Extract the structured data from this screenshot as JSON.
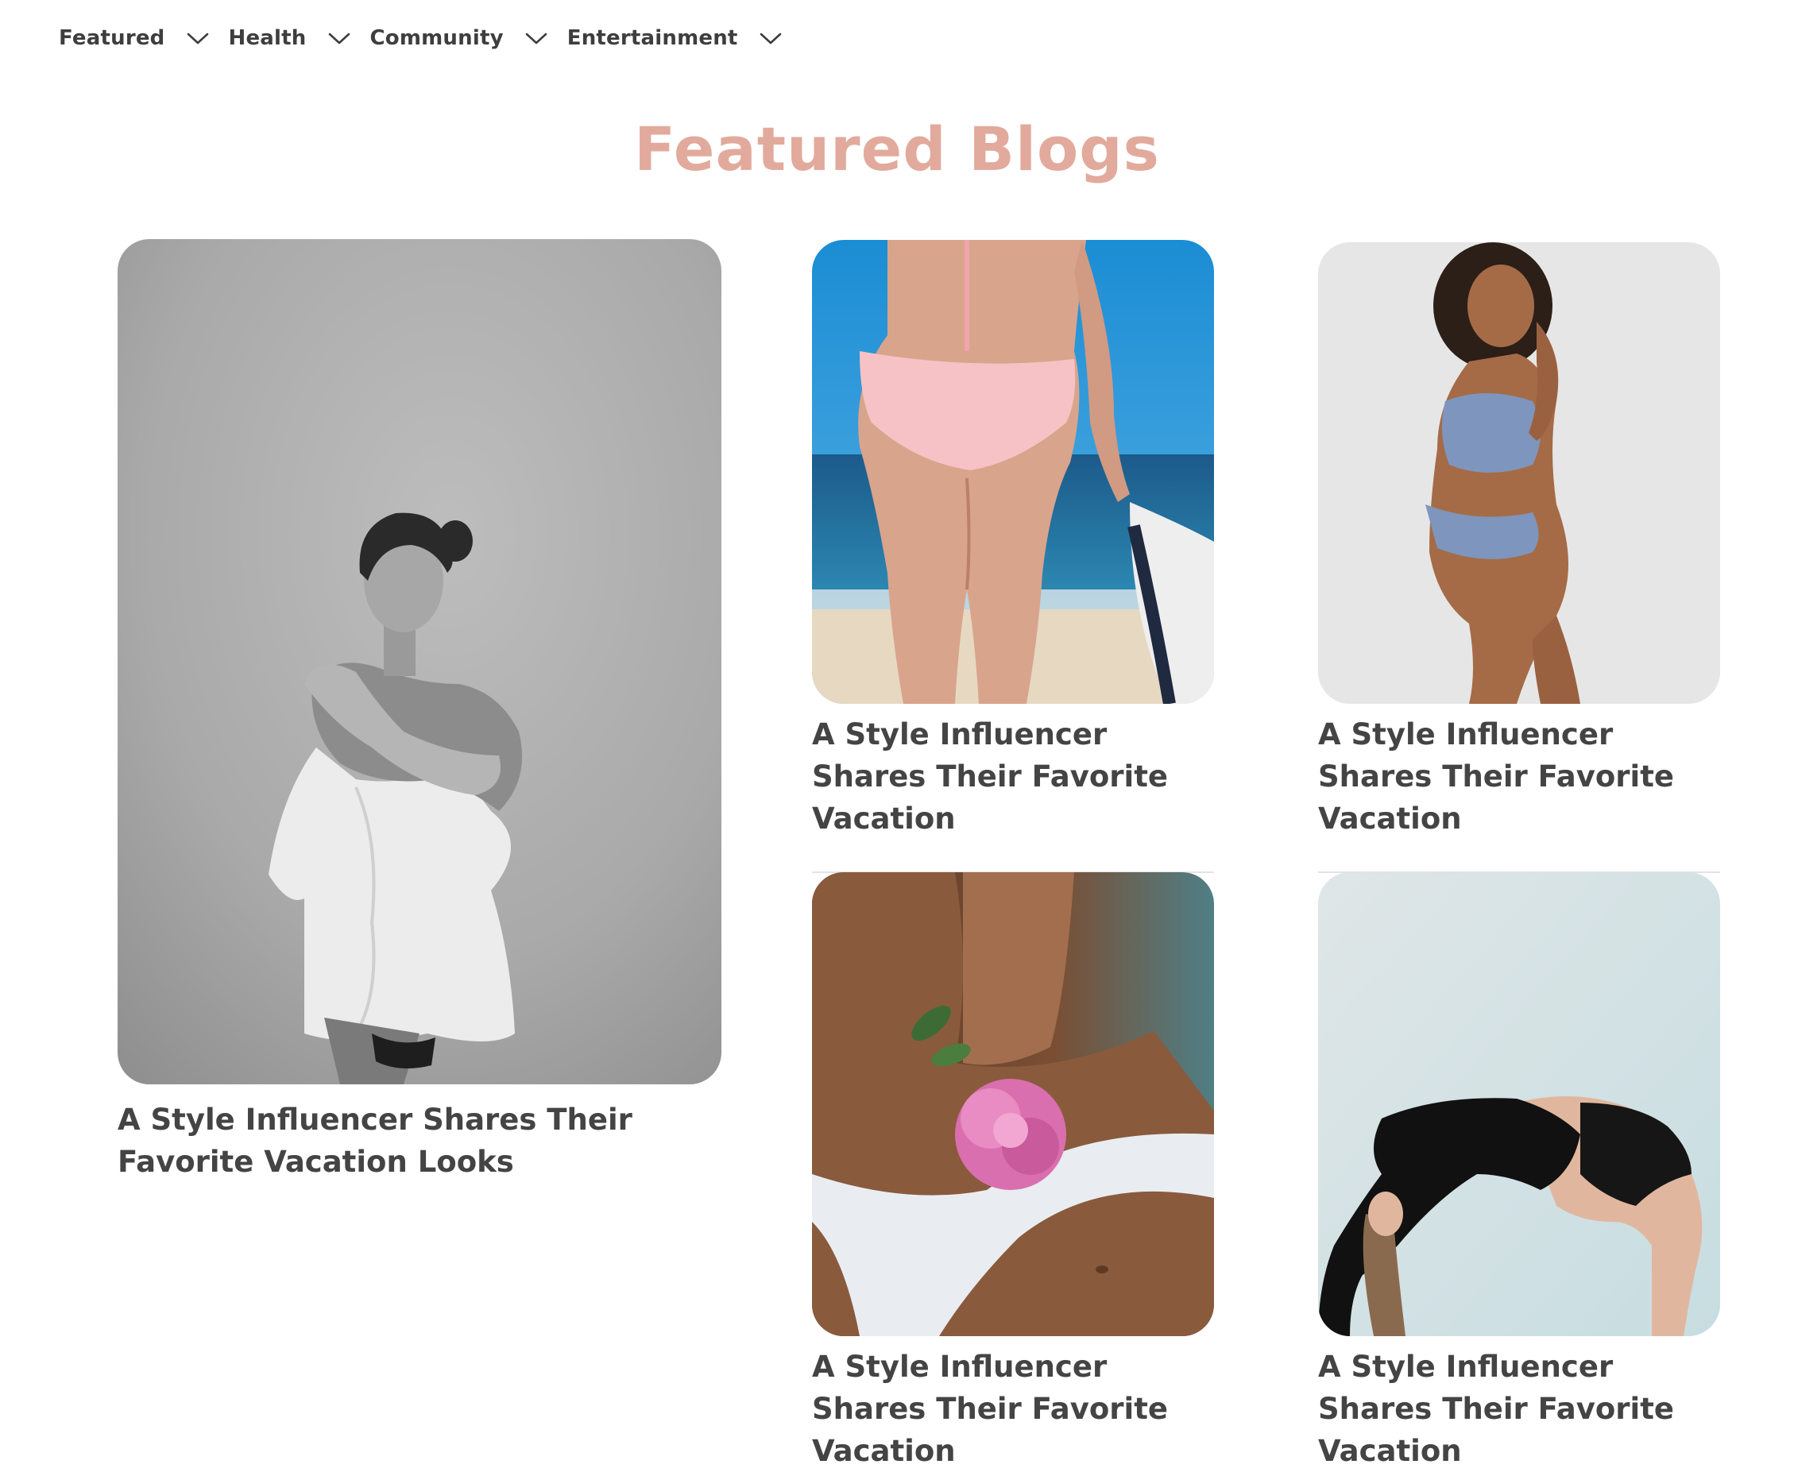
{
  "nav": {
    "items": [
      {
        "label": "Featured"
      },
      {
        "label": "Health"
      },
      {
        "label": "Community"
      },
      {
        "label": "Entertainment"
      }
    ]
  },
  "heading": "Featured Blogs",
  "colors": {
    "heading": "#e2aa9c",
    "text": "#444444",
    "background": "#ffffff"
  },
  "cards": [
    {
      "title": "A Style Influencer Shares Their Favorite Vacation Looks",
      "image": "woman-white-shirt-bw-photo"
    },
    {
      "title": "A Style Influencer Shares Their Favorite Vacation",
      "image": "pink-bikini-beach-photo"
    },
    {
      "title": "A Style Influencer Shares Their Favorite Vacation",
      "image": "blue-lingerie-woman-photo"
    },
    {
      "title": "A Style Influencer Shares Their Favorite Vacation",
      "image": "pink-flower-white-underwear-photo"
    },
    {
      "title": "A Style Influencer Shares Their Favorite Vacation",
      "image": "black-outfit-backbend-photo"
    }
  ]
}
